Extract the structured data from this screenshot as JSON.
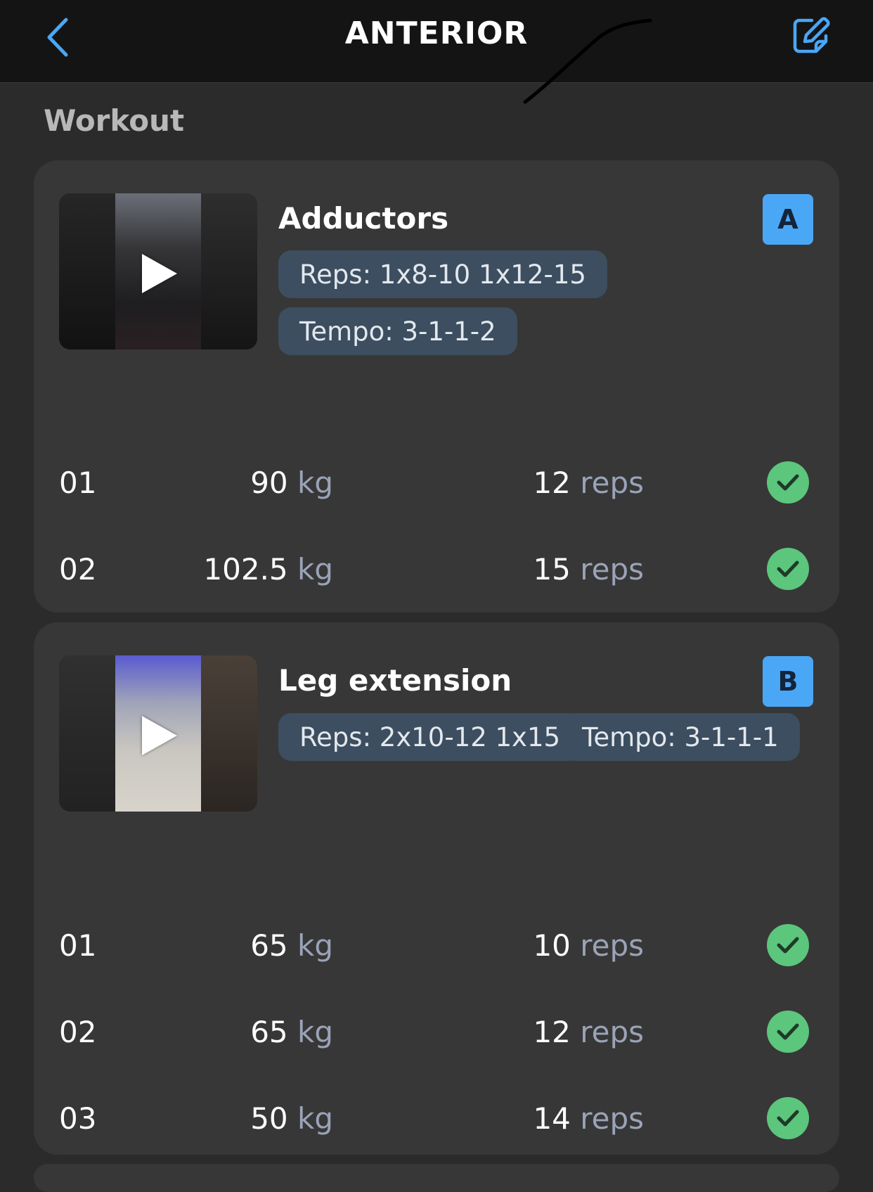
{
  "header": {
    "title": "ANTERIOR",
    "back_icon": "chevron-left-icon",
    "edit_icon": "edit-icon",
    "accent": "#4aa7f5"
  },
  "section_label": "Workout",
  "exercises": [
    {
      "name": "Adductors",
      "badge": "A",
      "reps": "Reps: 1x8-10 1x12-15",
      "tempo": "Tempo: 3-1-1-2",
      "sets": [
        {
          "num": "01",
          "weight": "90",
          "weight_unit": "kg",
          "reps": "12",
          "reps_unit": "reps",
          "done": true
        },
        {
          "num": "02",
          "weight": "102.5",
          "weight_unit": "kg",
          "reps": "15",
          "reps_unit": "reps",
          "done": true
        }
      ]
    },
    {
      "name": "Leg extension",
      "badge": "B",
      "reps": "Reps: 2x10-12 1x15",
      "tempo": "Tempo: 3-1-1-1",
      "sets": [
        {
          "num": "01",
          "weight": "65",
          "weight_unit": "kg",
          "reps": "10",
          "reps_unit": "reps",
          "done": true
        },
        {
          "num": "02",
          "weight": "65",
          "weight_unit": "kg",
          "reps": "12",
          "reps_unit": "reps",
          "done": true
        },
        {
          "num": "03",
          "weight": "50",
          "weight_unit": "kg",
          "reps": "14",
          "reps_unit": "reps",
          "done": true
        }
      ]
    }
  ],
  "colors": {
    "background": "#2b2b2b",
    "card": "#373737",
    "chip": "#3c4e5f",
    "check": "#5cc67c",
    "badge": "#4aa7f5"
  }
}
